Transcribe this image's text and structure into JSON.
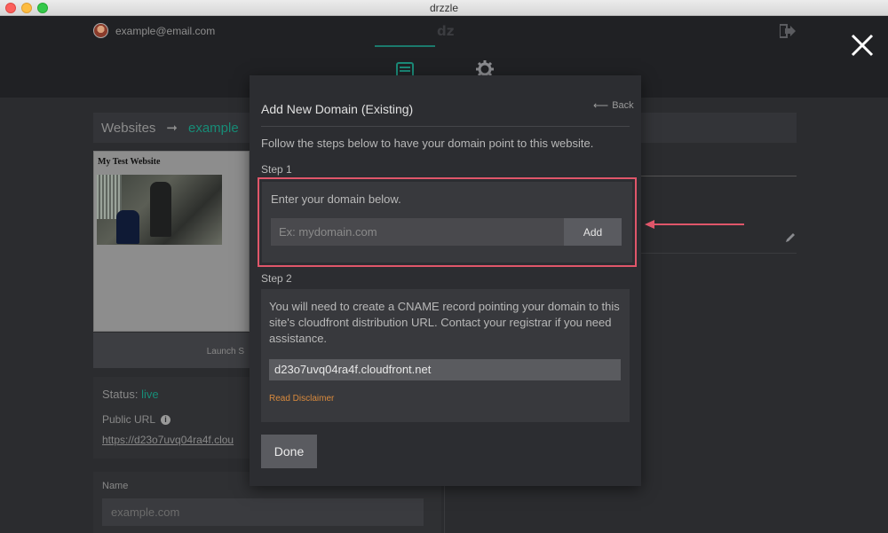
{
  "window": {
    "title": "drzzle"
  },
  "header": {
    "user_email": "example@email.com",
    "logo": "dz"
  },
  "background": {
    "breadcrumb": {
      "root": "Websites",
      "arrow": "➞",
      "current": "example"
    },
    "preview": {
      "site_title": "My Test Website",
      "launch_label": "Launch S"
    },
    "status": {
      "label": "Status:",
      "value": "live",
      "public_url_label": "Public URL",
      "info": "i",
      "url": "https://d23o7uvq04ra4f.clou"
    },
    "name": {
      "label": "Name",
      "value": "example.com"
    }
  },
  "modal": {
    "title": "Add New Domain (Existing)",
    "back_label": "Back",
    "back_arrow": "⟵",
    "intro": "Follow the steps below to have your domain point to this website.",
    "step1": {
      "label": "Step 1",
      "instruction": "Enter your domain below.",
      "input_placeholder": "Ex: mydomain.com",
      "input_value": "",
      "add_label": "Add"
    },
    "step2": {
      "label": "Step 2",
      "instruction": "You will need to create a CNAME record pointing your domain to this site's cloudfront distribution URL. Contact your registrar if you need assistance.",
      "cname_value": "d23o7uvq04ra4f.cloudfront.net",
      "disclaimer_label": "Read Disclaimer"
    },
    "done_label": "Done"
  },
  "colors": {
    "accent": "#178c77",
    "highlight_border": "#e0566a",
    "disclaimer_link": "#d98a3d"
  },
  "icons": [
    "logout-icon",
    "website-editor-icon",
    "gear-icon",
    "close-icon",
    "back-arrow-icon",
    "pencil-icon",
    "info-icon"
  ]
}
